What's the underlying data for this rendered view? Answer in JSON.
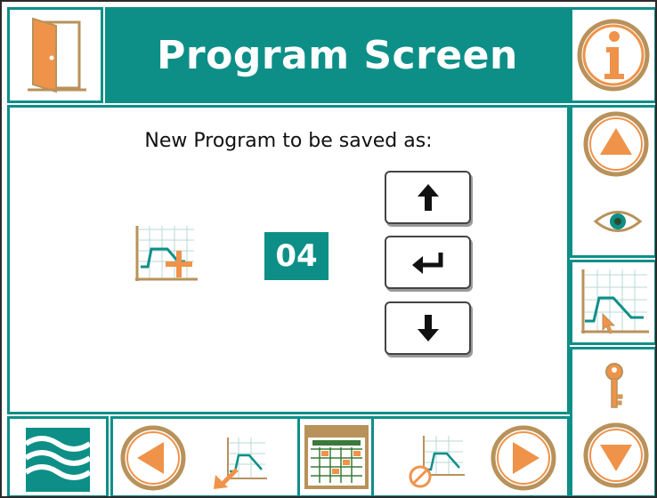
{
  "header": {
    "title": "Program Screen"
  },
  "main": {
    "prompt": "New Program to be saved as:",
    "program_number": "04"
  },
  "colors": {
    "teal": "#0d8f88",
    "orange": "#f0934a",
    "tan": "#b8925a"
  },
  "icons": {
    "exit": "door-exit-icon",
    "info": "info-icon",
    "new_program": "new-program-graph-icon",
    "up": "arrow-up-icon",
    "enter": "enter-icon",
    "down": "arrow-down-icon",
    "scroll_up": "scroll-up-icon",
    "view": "eye-icon",
    "graph": "program-graph-icon",
    "key": "key-icon",
    "scroll_down": "scroll-down-icon",
    "logo": "wave-logo-icon",
    "prev": "prev-icon",
    "import": "import-program-icon",
    "calendar": "calendar-icon",
    "delete": "delete-program-icon",
    "next": "next-icon"
  }
}
